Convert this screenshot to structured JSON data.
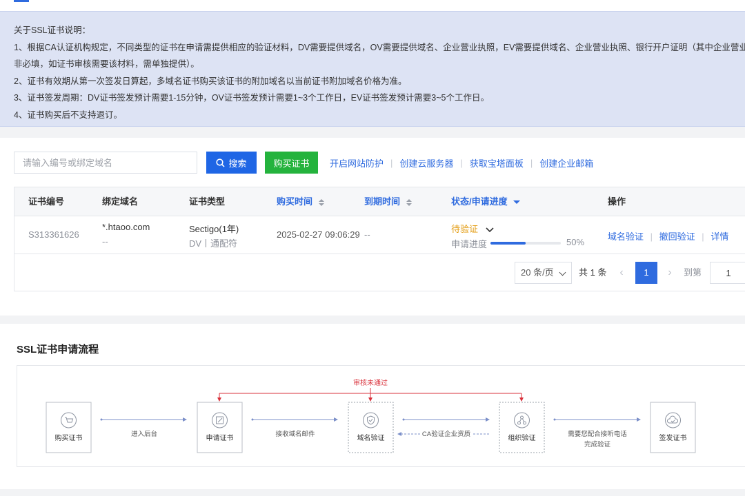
{
  "notice": {
    "title": "关于SSL证书说明：",
    "lines": [
      "1、根据CA认证机构规定，不同类型的证书在申请需提供相应的验证材料，DV需要提供域名，OV需要提供域名、企业营业执照，EV需要提供域名、企业营业执照、银行开户证明（其中企业营业执照",
      "非必填，如证书审核需要该材料，需单独提供）。",
      "2、证书有效期从第一次签发日算起，多域名证书购买该证书的附加域名以当前证书附加域名价格为准。",
      "3、证书签发周期：DV证书签发预计需要1-15分钟，OV证书签发预计需要1~3个工作日，EV证书签发预计需要3~5个工作日。",
      "4、证书购买后不支持退订。"
    ]
  },
  "toolbar": {
    "search_placeholder": "请输入编号或绑定域名",
    "search_label": "搜索",
    "buy_label": "购买证书",
    "links": [
      "开启网站防护",
      "创建云服务器",
      "获取宝塔面板",
      "创建企业邮箱"
    ]
  },
  "table": {
    "headers": {
      "cert_no": "证书编号",
      "domain": "绑定域名",
      "type": "证书类型",
      "buy_time": "购买时间",
      "expire_time": "到期时间",
      "status": "状态/申请进度",
      "ops": "操作"
    },
    "rows": [
      {
        "cert_no": "S313361626",
        "domain": "*.htaoo.com",
        "domain_sub": "--",
        "type": "Sectigo(1年)",
        "type_sub": "DV丨通配符",
        "buy_time": "2025-02-27 09:06:29",
        "expire_time": "--",
        "status": "待验证",
        "progress_label": "申请进度",
        "progress": 50,
        "progress_text": "50%",
        "ops": [
          "域名验证",
          "撤回验证",
          "详情"
        ]
      }
    ]
  },
  "pager": {
    "page_size": "20 条/页",
    "total": "共 1 条",
    "current": "1",
    "goto_label": "到第",
    "goto_value": "1"
  },
  "flow": {
    "title": "SSL证书申请流程",
    "reject_label": "审核未通过",
    "steps": [
      "购买证书",
      "申请证书",
      "域名验证",
      "组织验证",
      "签发证书"
    ],
    "arrows": [
      "进入后台",
      "接收域名邮件",
      "CA验证企业资质",
      "需要您配合接听电话",
      "完成验证"
    ]
  },
  "colors": {
    "primary": "#2f6bdf",
    "search_btn": "#1f66e5",
    "buy_btn": "#24b33d",
    "pending": "#e39b0f",
    "reject": "#d9313b",
    "notice_bg": "#dde3f4"
  }
}
